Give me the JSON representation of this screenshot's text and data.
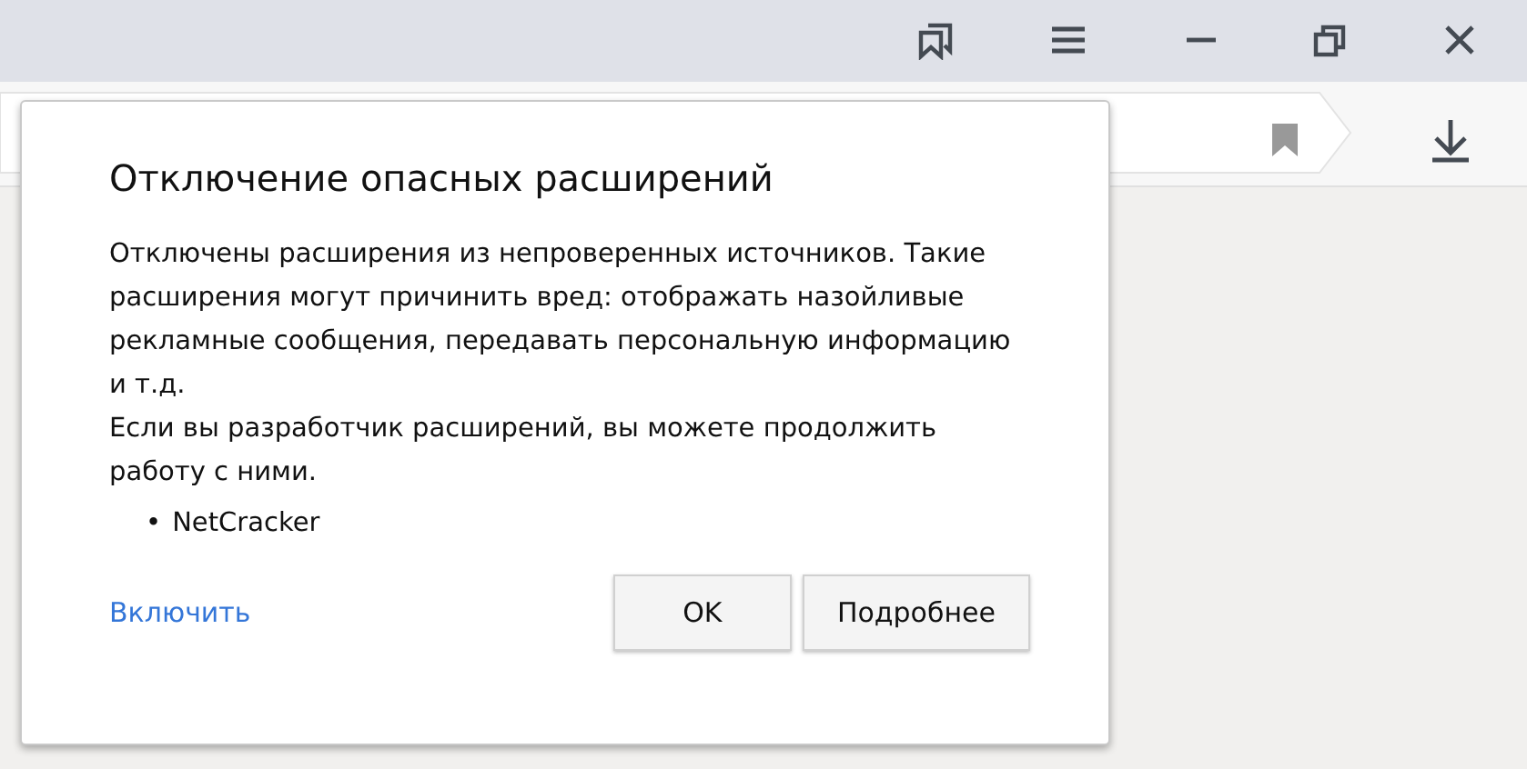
{
  "dialog": {
    "title": "Отключение опасных расширений",
    "paragraphs": [
      "Отключены расширения из непроверенных источников. Такие расширения могут причинить вред: отображать назойливые рекламные сообщения, передавать персональную информацию и т.д.",
      "Если вы разработчик расширений, вы можете продолжить работу с ними."
    ],
    "extensions": [
      {
        "bullet": "•",
        "name": "NetCracker"
      }
    ],
    "link": "Включить",
    "buttons": [
      "OK",
      "Подробнее"
    ]
  }
}
